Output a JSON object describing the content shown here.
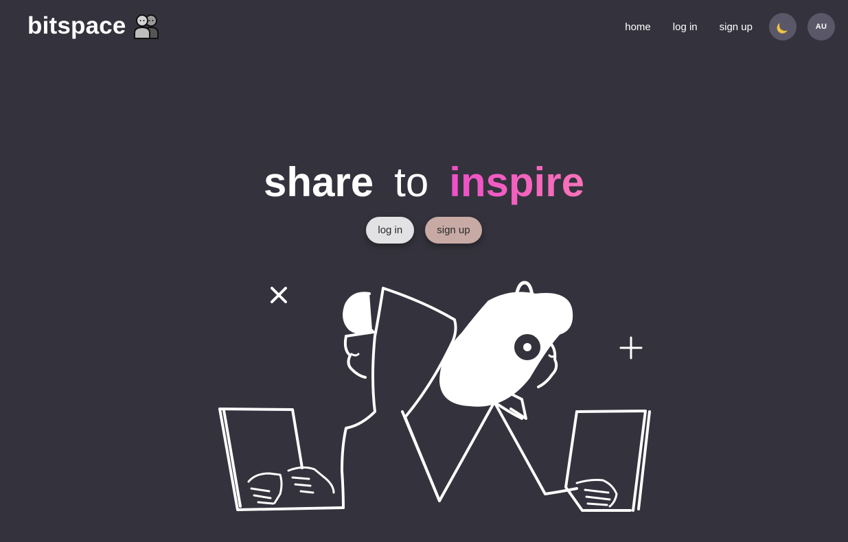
{
  "header": {
    "brand_name": "bitspace",
    "brand_icon": "two-people-icon",
    "nav": {
      "home": "home",
      "login": "log in",
      "signup": "sign up"
    },
    "theme_toggle_icon": "moon-icon",
    "avatar_initials": "AU"
  },
  "hero": {
    "word1": "share",
    "word2": "to",
    "word3": "inspire",
    "login_button": "log in",
    "signup_button": "sign up",
    "illustration": "two-people-back-to-back-at-laptops"
  },
  "colors": {
    "background": "#34333d",
    "accent_gradient_start": "#ee4fc8",
    "accent_gradient_end": "#f973b8",
    "login_button_bg": "#e2e2e4",
    "signup_button_bg": "#c8aaa5",
    "circle_button_bg": "#5a5868"
  }
}
